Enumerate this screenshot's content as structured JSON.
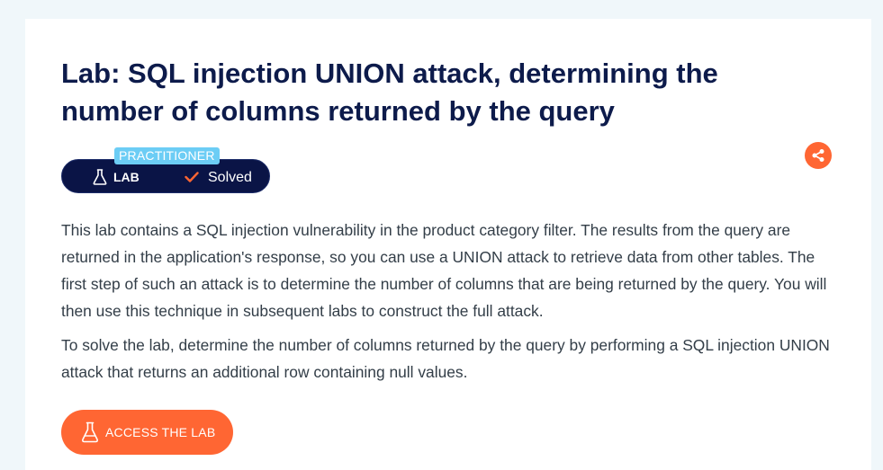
{
  "lab": {
    "title": "Lab: SQL injection UNION attack, determining the number of columns returned by the query",
    "level": "PRACTITIONER",
    "type_label": "LAB",
    "status": "Solved",
    "description": [
      "This lab contains a SQL injection vulnerability in the product category filter. The results from the query are returned in the application's response, so you can use a UNION attack to retrieve data from other tables. The first step of such an attack is to determine the number of columns that are being returned by the query. You will then use this technique in subsequent labs to construct the full attack.",
      "To solve the lab, determine the number of columns returned by the query by performing a SQL injection UNION attack that returns an additional row containing null values."
    ],
    "access_button": "ACCESS THE LAB"
  },
  "icons": {
    "lab": "flask-icon",
    "status": "check-icon",
    "share": "share-icon",
    "access": "flask-icon"
  },
  "colors": {
    "title": "#0d1b4b",
    "badge_bg": "#0a1446",
    "level_bg": "#6ccdf5",
    "accent": "#ff6633",
    "page_bg": "#f0f7fa"
  }
}
